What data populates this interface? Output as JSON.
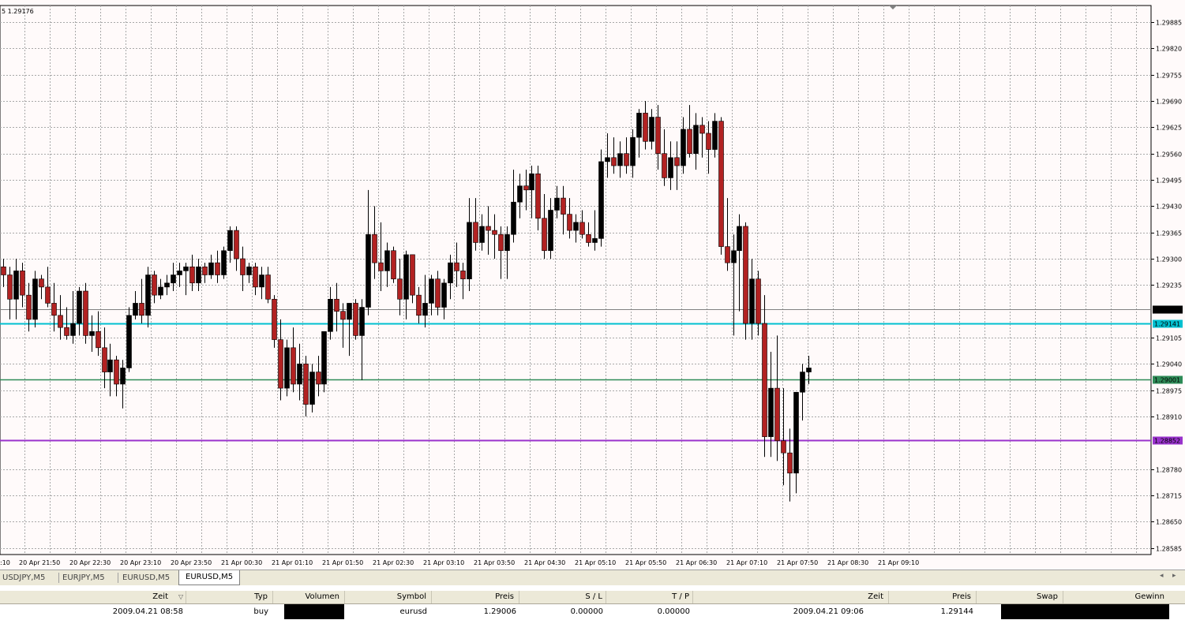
{
  "chart": {
    "info_label": "5 1.29176",
    "colors": {
      "background": "#fffafa",
      "grid": "#a8a8a8",
      "bull_body": "#000000",
      "bear_body": "#b22222",
      "wick": "#000000",
      "cyan_line": "#00c0d0",
      "green_line": "#2e8b57",
      "purple_line": "#9932cc",
      "bid_line": "#808080"
    }
  },
  "chart_data": {
    "type": "candlestick",
    "title": "",
    "xlabel": "",
    "ylabel": "",
    "symbol": "EURUSD,M5",
    "ylim": [
      1.2852,
      1.3
    ],
    "y_ticks": [
      "1.29885",
      "1.29820",
      "1.29755",
      "1.29690",
      "1.29625",
      "1.29560",
      "1.29495",
      "1.29430",
      "1.29365",
      "1.29300",
      "1.29235",
      "1.29105",
      "1.29040",
      "1.28975",
      "1.28910",
      "1.28780",
      "1.28715",
      "1.28650",
      "1.28585"
    ],
    "x_ticks": [
      ":10",
      "20 Apr 21:50",
      "20 Apr 22:30",
      "20 Apr 23:10",
      "20 Apr 23:50",
      "21 Apr 00:30",
      "21 Apr 01:10",
      "21 Apr 01:50",
      "21 Apr 02:30",
      "21 Apr 03:10",
      "21 Apr 03:50",
      "21 Apr 04:30",
      "21 Apr 05:10",
      "21 Apr 05:50",
      "21 Apr 06:30",
      "21 Apr 07:10",
      "21 Apr 07:50",
      "21 Apr 08:30",
      "21 Apr 09:10"
    ],
    "horizontal_lines": [
      {
        "label": "1.29176",
        "value": 1.29176,
        "style": "bid"
      },
      {
        "label": "1.29141",
        "value": 1.29141,
        "style": "cyan"
      },
      {
        "label": "1.29001",
        "value": 1.29001,
        "style": "green"
      },
      {
        "label": "1.28852",
        "value": 1.28852,
        "style": "purple"
      }
    ],
    "candles": [
      [
        1.2928,
        1.293,
        1.2923,
        1.2926
      ],
      [
        1.2926,
        1.2928,
        1.2915,
        1.292
      ],
      [
        1.292,
        1.293,
        1.2915,
        1.2927
      ],
      [
        1.2927,
        1.2929,
        1.2918,
        1.2921
      ],
      [
        1.2921,
        1.2924,
        1.2912,
        1.2915
      ],
      [
        1.2915,
        1.2927,
        1.2913,
        1.2925
      ],
      [
        1.2925,
        1.2926,
        1.292,
        1.2923
      ],
      [
        1.2923,
        1.2928,
        1.2918,
        1.2919
      ],
      [
        1.2919,
        1.2924,
        1.2912,
        1.2916
      ],
      [
        1.2916,
        1.2921,
        1.291,
        1.2913
      ],
      [
        1.2913,
        1.2918,
        1.291,
        1.2911
      ],
      [
        1.2911,
        1.2922,
        1.2909,
        1.2914
      ],
      [
        1.2914,
        1.2923,
        1.2911,
        1.2922
      ],
      [
        1.2922,
        1.2924,
        1.2909,
        1.2911
      ],
      [
        1.2911,
        1.2916,
        1.2907,
        1.2912
      ],
      [
        1.2912,
        1.2917,
        1.2906,
        1.2908
      ],
      [
        1.2908,
        1.2913,
        1.2898,
        1.2902
      ],
      [
        1.2902,
        1.2909,
        1.2896,
        1.2905
      ],
      [
        1.2905,
        1.2906,
        1.2896,
        1.2899
      ],
      [
        1.2899,
        1.2905,
        1.2893,
        1.2903
      ],
      [
        1.2903,
        1.2918,
        1.2902,
        1.2916
      ],
      [
        1.2916,
        1.2922,
        1.2915,
        1.2919
      ],
      [
        1.2919,
        1.2925,
        1.2914,
        1.2916
      ],
      [
        1.2916,
        1.2928,
        1.2913,
        1.2926
      ],
      [
        1.2926,
        1.2927,
        1.2919,
        1.2921
      ],
      [
        1.2921,
        1.2925,
        1.292,
        1.2923
      ],
      [
        1.2923,
        1.2926,
        1.2921,
        1.2924
      ],
      [
        1.2924,
        1.2929,
        1.2922,
        1.2926
      ],
      [
        1.2926,
        1.2929,
        1.2923,
        1.2927
      ],
      [
        1.2927,
        1.2929,
        1.2921,
        1.2928
      ],
      [
        1.2928,
        1.2931,
        1.2922,
        1.2924
      ],
      [
        1.2924,
        1.293,
        1.2922,
        1.2928
      ],
      [
        1.2928,
        1.2929,
        1.2924,
        1.2926
      ],
      [
        1.2926,
        1.2931,
        1.2925,
        1.2929
      ],
      [
        1.2929,
        1.2932,
        1.2924,
        1.2926
      ],
      [
        1.2926,
        1.2933,
        1.2925,
        1.2932
      ],
      [
        1.2932,
        1.2938,
        1.2929,
        1.2937
      ],
      [
        1.2937,
        1.2938,
        1.2927,
        1.293
      ],
      [
        1.293,
        1.2933,
        1.2922,
        1.2926
      ],
      [
        1.2926,
        1.2929,
        1.2924,
        1.2928
      ],
      [
        1.2928,
        1.2929,
        1.2921,
        1.2923
      ],
      [
        1.2923,
        1.2928,
        1.292,
        1.2926
      ],
      [
        1.2926,
        1.2928,
        1.2919,
        1.292
      ],
      [
        1.292,
        1.2921,
        1.2908,
        1.291
      ],
      [
        1.291,
        1.2915,
        1.2895,
        1.2898
      ],
      [
        1.2898,
        1.291,
        1.2896,
        1.2908
      ],
      [
        1.2908,
        1.2913,
        1.2897,
        1.2899
      ],
      [
        1.2899,
        1.2909,
        1.2895,
        1.2904
      ],
      [
        1.2904,
        1.2906,
        1.2891,
        1.2894
      ],
      [
        1.2894,
        1.2904,
        1.2892,
        1.2902
      ],
      [
        1.2902,
        1.2906,
        1.2896,
        1.2899
      ],
      [
        1.2899,
        1.2912,
        1.2897,
        1.2912
      ],
      [
        1.2912,
        1.2923,
        1.291,
        1.292
      ],
      [
        1.292,
        1.2924,
        1.2912,
        1.2917
      ],
      [
        1.2917,
        1.2919,
        1.2908,
        1.2915
      ],
      [
        1.2915,
        1.2919,
        1.2906,
        1.2919
      ],
      [
        1.2919,
        1.292,
        1.291,
        1.2911
      ],
      [
        1.2911,
        1.292,
        1.29,
        1.2918
      ],
      [
        1.2918,
        1.2947,
        1.2916,
        1.2936
      ],
      [
        1.2936,
        1.2943,
        1.2925,
        1.2929
      ],
      [
        1.2929,
        1.2939,
        1.2922,
        1.2927
      ],
      [
        1.2927,
        1.2934,
        1.2923,
        1.2932
      ],
      [
        1.2932,
        1.2933,
        1.2924,
        1.2925
      ],
      [
        1.2925,
        1.293,
        1.2916,
        1.292
      ],
      [
        1.292,
        1.2932,
        1.2915,
        1.2931
      ],
      [
        1.2931,
        1.2931,
        1.2919,
        1.2921
      ],
      [
        1.2921,
        1.2923,
        1.2914,
        1.2916
      ],
      [
        1.2916,
        1.2926,
        1.2913,
        1.2919
      ],
      [
        1.2919,
        1.2926,
        1.2916,
        1.2925
      ],
      [
        1.2925,
        1.2927,
        1.2916,
        1.2918
      ],
      [
        1.2918,
        1.2925,
        1.2915,
        1.2924
      ],
      [
        1.2924,
        1.2931,
        1.292,
        1.2929
      ],
      [
        1.2929,
        1.2934,
        1.2923,
        1.2927
      ],
      [
        1.2927,
        1.2929,
        1.292,
        1.2925
      ],
      [
        1.2925,
        1.2945,
        1.2922,
        1.2939
      ],
      [
        1.2939,
        1.2945,
        1.2932,
        1.2934
      ],
      [
        1.2934,
        1.2941,
        1.2932,
        1.2938
      ],
      [
        1.2938,
        1.2943,
        1.2931,
        1.2937
      ],
      [
        1.2937,
        1.2941,
        1.293,
        1.2936
      ],
      [
        1.2936,
        1.2938,
        1.2925,
        1.2932
      ],
      [
        1.2932,
        1.2938,
        1.2925,
        1.2936
      ],
      [
        1.2936,
        1.2952,
        1.2934,
        1.2944
      ],
      [
        1.2944,
        1.2951,
        1.294,
        1.2948
      ],
      [
        1.2948,
        1.2952,
        1.2942,
        1.2947
      ],
      [
        1.2947,
        1.2953,
        1.294,
        1.2951
      ],
      [
        1.2951,
        1.2953,
        1.2937,
        1.294
      ],
      [
        1.294,
        1.2946,
        1.293,
        1.2932
      ],
      [
        1.2932,
        1.2945,
        1.293,
        1.2942
      ],
      [
        1.2942,
        1.2948,
        1.294,
        1.2945
      ],
      [
        1.2945,
        1.2948,
        1.2936,
        1.2941
      ],
      [
        1.2941,
        1.2945,
        1.2935,
        1.2937
      ],
      [
        1.2937,
        1.2941,
        1.2934,
        1.2939
      ],
      [
        1.2939,
        1.2942,
        1.2935,
        1.2936
      ],
      [
        1.2936,
        1.2939,
        1.2933,
        1.2934
      ],
      [
        1.2934,
        1.2942,
        1.2932,
        1.2935
      ],
      [
        1.2935,
        1.2957,
        1.2933,
        1.2954
      ],
      [
        1.2954,
        1.2961,
        1.295,
        1.2955
      ],
      [
        1.2955,
        1.296,
        1.2951,
        1.2953
      ],
      [
        1.2953,
        1.2959,
        1.295,
        1.2956
      ],
      [
        1.2956,
        1.296,
        1.2951,
        1.2953
      ],
      [
        1.2953,
        1.2962,
        1.295,
        1.296
      ],
      [
        1.296,
        1.2967,
        1.2955,
        1.2966
      ],
      [
        1.2966,
        1.2969,
        1.2957,
        1.2959
      ],
      [
        1.2959,
        1.2967,
        1.2957,
        1.2965
      ],
      [
        1.2965,
        1.2968,
        1.2952,
        1.2956
      ],
      [
        1.2956,
        1.2962,
        1.2948,
        1.295
      ],
      [
        1.295,
        1.2959,
        1.2947,
        1.2955
      ],
      [
        1.2955,
        1.2959,
        1.2947,
        1.2953
      ],
      [
        1.2953,
        1.2965,
        1.2951,
        1.2962
      ],
      [
        1.2962,
        1.2968,
        1.2955,
        1.2956
      ],
      [
        1.2956,
        1.2966,
        1.2952,
        1.2963
      ],
      [
        1.2963,
        1.2965,
        1.2955,
        1.2961
      ],
      [
        1.2961,
        1.2964,
        1.2951,
        1.2957
      ],
      [
        1.2957,
        1.2966,
        1.2955,
        1.2964
      ],
      [
        1.2964,
        1.2965,
        1.2931,
        1.2933
      ],
      [
        1.2933,
        1.2945,
        1.2927,
        1.2929
      ],
      [
        1.2929,
        1.2936,
        1.2911,
        1.2932
      ],
      [
        1.2932,
        1.2941,
        1.2917,
        1.2938
      ],
      [
        1.2938,
        1.2939,
        1.291,
        1.2914
      ],
      [
        1.2914,
        1.293,
        1.291,
        1.2925
      ],
      [
        1.2925,
        1.2927,
        1.2911,
        1.2914
      ],
      [
        1.2914,
        1.2921,
        1.2881,
        1.2886
      ],
      [
        1.2886,
        1.2907,
        1.2881,
        1.2898
      ],
      [
        1.2898,
        1.2911,
        1.288,
        1.2885
      ],
      [
        1.2885,
        1.2898,
        1.2874,
        1.2882
      ],
      [
        1.2882,
        1.2888,
        1.287,
        1.2877
      ],
      [
        1.2877,
        1.2897,
        1.2872,
        1.2897
      ],
      [
        1.2897,
        1.2904,
        1.289,
        1.2902
      ],
      [
        1.2902,
        1.2906,
        1.2899,
        1.2903
      ]
    ]
  },
  "tabs": [
    {
      "label": "USDJPY,M5",
      "active": false
    },
    {
      "label": "EURJPY,M5",
      "active": false
    },
    {
      "label": "EURUSD,M5",
      "active": false
    },
    {
      "label": "EURUSD,M5",
      "active": true
    }
  ],
  "tab_scroll": {
    "left": "◂",
    "right": "▸"
  },
  "terminal": {
    "headers": {
      "zeit": "Zeit",
      "sort_marker": "▽",
      "typ": "Typ",
      "volumen": "Volumen",
      "symbol": "Symbol",
      "preis": "Preis",
      "sl": "S / L",
      "tp": "T / P",
      "zeit2": "Zeit",
      "preis2": "Preis",
      "swap": "Swap",
      "gewinn": "Gewinn"
    },
    "row": {
      "zeit": "2009.04.21 08:58",
      "typ": "buy",
      "symbol": "eurusd",
      "preis": "1.29006",
      "sl": "0.00000",
      "tp": "0.00000",
      "zeit2": "2009.04.21 09:06",
      "preis2": "1.29144"
    }
  }
}
